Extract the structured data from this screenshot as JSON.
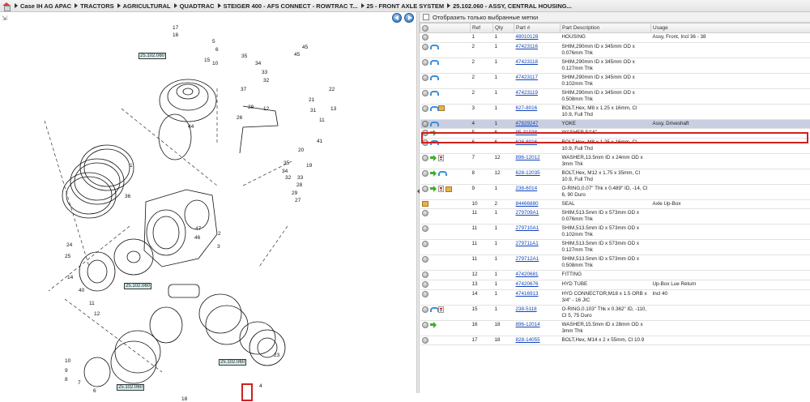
{
  "breadcrumb": [
    "Case IH AG APAC",
    "TRACTORS",
    "AGRICULTURAL",
    "QUADTRAC",
    "STEIGER 400 - AFS CONNECT - ROWTRAC T...",
    "25 - FRONT AXLE SYSTEM",
    "25.102.060 - ASSY, CENTRAL HOUSING..."
  ],
  "filter_label": "Отобразить только выбранные метки",
  "columns": {
    "ref": "Ref",
    "qty": "Qty",
    "part": "Part #",
    "desc": "Part Description",
    "usage": "Usage"
  },
  "rows": [
    {
      "ref": "1",
      "qty": "1",
      "part": "48010128",
      "desc": "HOUSING",
      "usage": "Assy, Front, Incl 36 - 38",
      "icons": [
        "gray"
      ]
    },
    {
      "ref": "2",
      "qty": "1",
      "part": "47423116",
      "desc": "SHIM,290mm ID x 345mm OD x 0.076mm Thk",
      "usage": "",
      "icons": [
        "gray",
        "blue"
      ]
    },
    {
      "ref": "2",
      "qty": "1",
      "part": "47423118",
      "desc": "SHIM,290mm ID x 345mm OD x 0.127mm Thk",
      "usage": "",
      "icons": [
        "gray",
        "blue"
      ]
    },
    {
      "ref": "2",
      "qty": "1",
      "part": "47423117",
      "desc": "SHIM,290mm ID x 345mm OD x 0.102mm Thk",
      "usage": "",
      "icons": [
        "gray",
        "blue"
      ]
    },
    {
      "ref": "2",
      "qty": "1",
      "part": "47423119",
      "desc": "SHIM,290mm ID x 345mm OD x 0.508mm Thk",
      "usage": "",
      "icons": [
        "gray",
        "blue"
      ]
    },
    {
      "ref": "3",
      "qty": "1",
      "part": "627-8016",
      "desc": "BOLT,Hex, M8 x 1.25 x 16mm, Cl 10.9, Full Thd",
      "usage": "",
      "icons": [
        "gray",
        "blue",
        "box"
      ]
    },
    {
      "ref": "4",
      "qty": "1",
      "part": "47829247",
      "desc": "YOKE",
      "usage": "Assy, Driveshaft",
      "icons": [
        "gray2",
        "blue"
      ],
      "selected": true
    },
    {
      "ref": "5",
      "qty": "6",
      "part": "95-31038",
      "desc": "WASHER,5/16\"",
      "usage": "",
      "icons": [
        "gray",
        "green"
      ]
    },
    {
      "ref": "6",
      "qty": "6",
      "part": "628-8016",
      "desc": "BOLT,Hex, M8 x 1.25 x 16mm, Cl 10.9, Full Thd",
      "usage": "",
      "icons": [
        "gray",
        "blue"
      ]
    },
    {
      "ref": "7",
      "qty": "12",
      "part": "896-12012",
      "desc": "WASHER,13.5mm ID x 24mm OD x 3mm Thk",
      "usage": "",
      "icons": [
        "gray",
        "green",
        "doc"
      ]
    },
    {
      "ref": "8",
      "qty": "12",
      "part": "628-12035",
      "desc": "BOLT,Hex, M12 x 1.75 x 35mm, Cl 10.9, Full Thd",
      "usage": "",
      "icons": [
        "gray",
        "green",
        "blue"
      ]
    },
    {
      "ref": "9",
      "qty": "1",
      "part": "238-6014",
      "desc": "O-RING,0.07\" Thk x 0.489\" ID, -14, Cl 6, 90 Duro",
      "usage": "",
      "icons": [
        "gray",
        "green",
        "doc",
        "box"
      ]
    },
    {
      "ref": "10",
      "qty": "2",
      "part": "84466880",
      "desc": "SEAL",
      "usage": "Axle Up-Box",
      "icons": [
        "box"
      ]
    },
    {
      "ref": "11",
      "qty": "1",
      "part": "279709A1",
      "desc": "SHIM,513.5mm ID x 573mm OD x 0.076mm Thk",
      "usage": "",
      "icons": [
        "gray"
      ]
    },
    {
      "ref": "11",
      "qty": "1",
      "part": "279710A1",
      "desc": "SHIM,513.5mm ID x 573mm OD x 0.102mm Thk",
      "usage": "",
      "icons": [
        "gray"
      ]
    },
    {
      "ref": "11",
      "qty": "1",
      "part": "279711A1",
      "desc": "SHIM,513.5mm ID x 573mm OD x 0.127mm Thk",
      "usage": "",
      "icons": [
        "gray"
      ]
    },
    {
      "ref": "11",
      "qty": "1",
      "part": "279712A1",
      "desc": "SHIM,513.5mm ID x 573mm OD x 0.508mm Thk",
      "usage": "",
      "icons": [
        "gray"
      ]
    },
    {
      "ref": "12",
      "qty": "1",
      "part": "47420681",
      "desc": "FITTING",
      "usage": "",
      "icons": [
        "gray"
      ]
    },
    {
      "ref": "13",
      "qty": "1",
      "part": "47420676",
      "desc": "HYD TUBE",
      "usage": "Up-Box Lue Return",
      "icons": [
        "gray"
      ]
    },
    {
      "ref": "14",
      "qty": "1",
      "part": "47416913",
      "desc": "HYD CONNECTOR,M18 x 1.5 ORB x 3/4\" - 16 JIC",
      "usage": "Incl 40",
      "icons": [
        "gray"
      ]
    },
    {
      "ref": "15",
      "qty": "1",
      "part": "238-5118",
      "desc": "O-RING,0.103\" Thk x 0.362\" ID, -110, Cl 5, 75 Duro",
      "usage": "",
      "icons": [
        "gray",
        "blue",
        "doc"
      ]
    },
    {
      "ref": "16",
      "qty": "18",
      "part": "896-12014",
      "desc": "WASHER,15.5mm ID x 28mm OD x 3mm Thk",
      "usage": "",
      "icons": [
        "gray",
        "green"
      ]
    },
    {
      "ref": "17",
      "qty": "18",
      "part": "828-14055",
      "desc": "BOLT,Hex, M14 x 2 x 55mm, Cl 10.9",
      "usage": "",
      "icons": [
        "gray"
      ]
    }
  ],
  "diagram": {
    "refs": [
      "25.102.060",
      "25.102.060",
      "25.102.060",
      "25.102.060"
    ],
    "callouts": [
      "17",
      "16",
      "5",
      "6",
      "15",
      "10",
      "35",
      "34",
      "33",
      "32",
      "45",
      "45",
      "21",
      "22",
      "37",
      "31",
      "13",
      "11",
      "44",
      "1",
      "36",
      "20",
      "41",
      "19",
      "26",
      "39",
      "12",
      "2",
      "35",
      "34",
      "32",
      "33",
      "28",
      "29",
      "27",
      "47",
      "46",
      "3",
      "24",
      "25",
      "14",
      "40",
      "11",
      "12",
      "10",
      "9",
      "8",
      "7",
      "6",
      "18",
      "23",
      "4"
    ]
  }
}
